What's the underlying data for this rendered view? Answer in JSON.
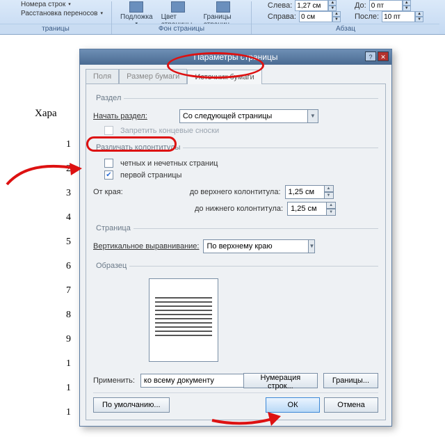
{
  "ribbon": {
    "group_page_setup_label": "траницы",
    "btn_line_numbers": "Номера строк",
    "btn_hyphenation": "Расстановка переносов",
    "group_bg_label": "Фон страницы",
    "btn_watermark": "Подложка",
    "btn_page_color": "Цвет страницы",
    "btn_page_borders": "Границы страниц",
    "group_para_label": "Абзац",
    "left_label": "Слева:",
    "left_val": "1,27 см",
    "right_label": "Справа:",
    "right_val": "0 см",
    "before_label": "До:",
    "before_val": "0 пт",
    "after_label": "После:",
    "after_val": "10 пт"
  },
  "doc_text": "Хара",
  "doc_nums": [
    "1",
    "2",
    "3",
    "4",
    "5",
    "6",
    "7",
    "8",
    "9",
    "1",
    "1",
    "1"
  ],
  "dialog": {
    "title": "Параметры страницы",
    "tab_margins": "Поля",
    "tab_paper": "Размер бумаги",
    "tab_source": "Источник бумаги",
    "section_group": "Раздел",
    "start_label": "Начать раздел:",
    "start_value": "Со следующей страницы",
    "suppress_endnotes": "Запретить концевые сноски",
    "headers_group": "Различать колонтитулы",
    "diff_odd_even": "четных и нечетных страниц",
    "diff_first": "первой страницы",
    "from_edge": "От края:",
    "to_header": "до верхнего колонтитула:",
    "to_header_val": "1,25 см",
    "to_footer": "до нижнего колонтитула:",
    "to_footer_val": "1,25 см",
    "page_group": "Страница",
    "valign_label": "Вертикальное выравнивание:",
    "valign_value": "По верхнему краю",
    "preview_group": "Образец",
    "apply_label": "Применить:",
    "apply_value": "ко всему документу",
    "btn_linenumbers": "Нумерация строк...",
    "btn_borders": "Границы...",
    "btn_default": "По умолчанию...",
    "btn_ok": "ОК",
    "btn_cancel": "Отмена"
  }
}
